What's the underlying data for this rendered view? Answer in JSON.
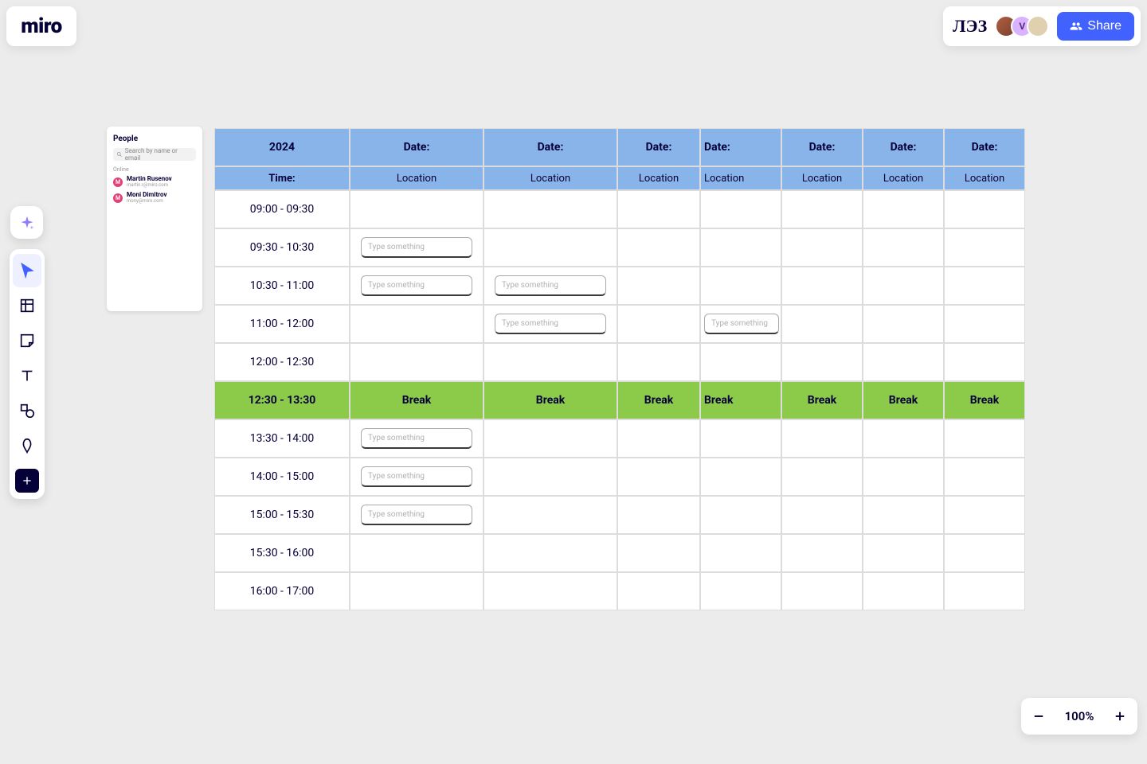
{
  "app": {
    "logo": "miro",
    "board_title": "ЛЭЗ"
  },
  "share": {
    "label": "Share"
  },
  "avatars": [
    {
      "initial": ""
    },
    {
      "initial": "V"
    },
    {
      "initial": ""
    }
  ],
  "people": {
    "header": "People",
    "search_placeholder": "Search by name or email",
    "section": "Online",
    "list": [
      {
        "initial": "M",
        "name": "Martin Rusenov",
        "email": "martin.r@miro.com"
      },
      {
        "initial": "M",
        "name": "Moni Dimitrov",
        "email": "mony@miro.com"
      }
    ]
  },
  "schedule": {
    "year": "2024",
    "date_label": "Date:",
    "time_label": "Time:",
    "location_label": "Location",
    "break_label": "Break",
    "placeholder": "Type something",
    "num_location_cols": 7,
    "rows": [
      {
        "time": "09:00 - 09:30",
        "inputs": []
      },
      {
        "time": "09:30 - 10:30",
        "inputs": [
          1
        ]
      },
      {
        "time": "10:30 - 11:00",
        "inputs": [
          1,
          2
        ]
      },
      {
        "time": "11:00 - 12:00",
        "inputs": [
          2,
          4
        ]
      },
      {
        "time": "12:00 - 12:30",
        "inputs": []
      },
      {
        "time": "12:30 - 13:30",
        "break": true
      },
      {
        "time": "13:30 - 14:00",
        "inputs": [
          1
        ]
      },
      {
        "time": "14:00 - 15:00",
        "inputs": [
          1
        ]
      },
      {
        "time": "15:00 - 15:30",
        "inputs": [
          1
        ]
      },
      {
        "time": "15:30 - 16:00",
        "inputs": []
      },
      {
        "time": "16:00 - 17:00",
        "inputs": []
      }
    ]
  },
  "zoom": {
    "value": "100%"
  },
  "tools": {
    "ai": "ai",
    "select": "select",
    "frame": "frame",
    "sticky": "sticky",
    "text": "text",
    "shapes": "shapes",
    "pen": "pen",
    "more": "more"
  }
}
